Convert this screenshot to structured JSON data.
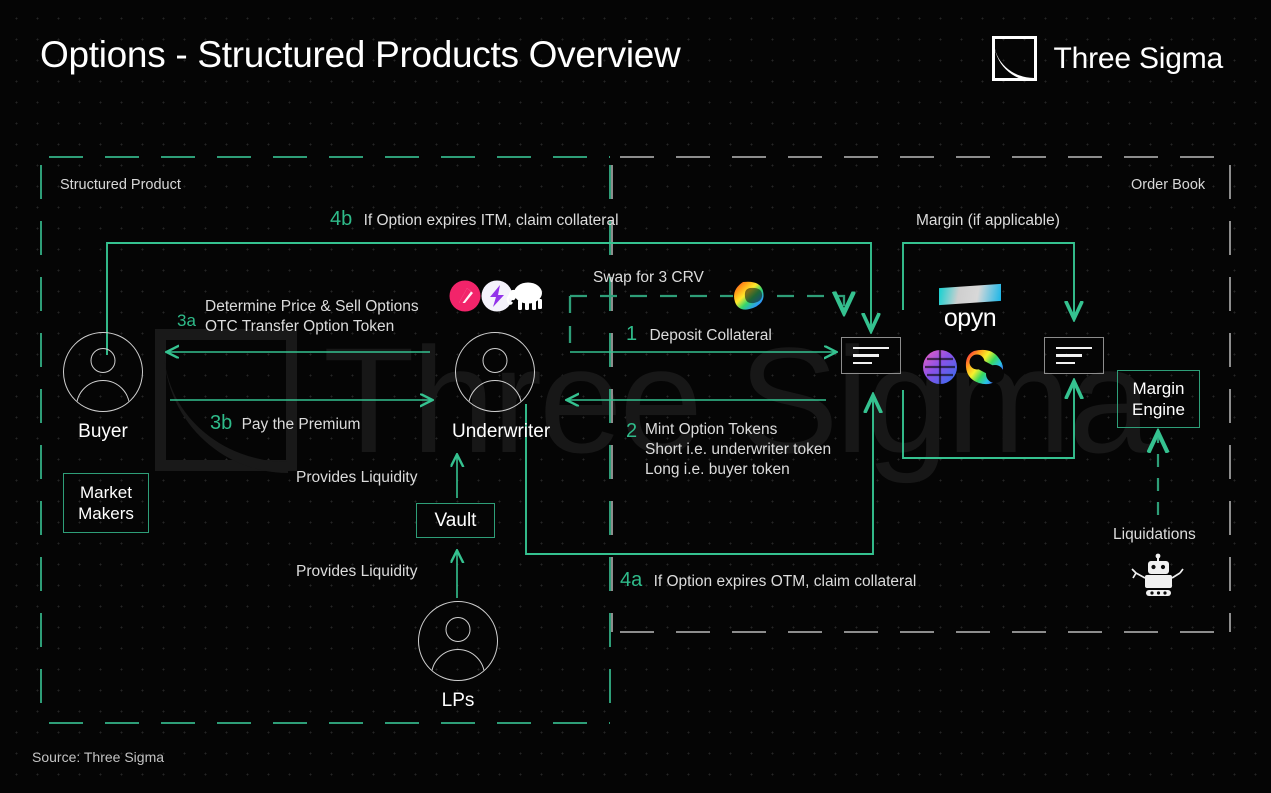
{
  "header": {
    "title": "Options - Structured Products Overview",
    "logo_text": "Three Sigma",
    "logo_mark": "three-sigma-mark"
  },
  "footer": {
    "source": "Source: Three Sigma"
  },
  "watermark": {
    "text": "Three Sigma"
  },
  "zones": {
    "structured_product": {
      "label": "Structured Product",
      "border_color": "#2e9e78",
      "style": "dashed"
    },
    "order_book": {
      "label": "Order Book",
      "border_color": "#8d8d8d",
      "style": "dashed"
    }
  },
  "colors": {
    "accent_green": "#2fbb8a",
    "line_green": "#35c290",
    "gray_line": "#8d8d8d",
    "background": "#050505",
    "text": "#dcdcdc"
  },
  "actors": [
    {
      "id": "buyer",
      "label": "Buyer",
      "icon": "user-avatar-icon"
    },
    {
      "id": "underwriter",
      "label": "Underwriter",
      "icon": "user-avatar-icon"
    },
    {
      "id": "lps",
      "label": "LPs",
      "icon": "user-avatar-icon"
    }
  ],
  "boxes": [
    {
      "id": "market-makers",
      "label": "Market\nMakers",
      "line1": "Market",
      "line2": "Makers"
    },
    {
      "id": "vault",
      "label": "Vault"
    },
    {
      "id": "margin-engine",
      "line1": "Margin",
      "line2": "Engine"
    }
  ],
  "flows": [
    {
      "id": "4b",
      "number": "4b",
      "text": "If Option expires ITM, claim collateral"
    },
    {
      "id": "3a",
      "number": "3a",
      "text_line1": "Determine Price & Sell Options",
      "text_line2": "OTC Transfer Option Token"
    },
    {
      "id": "3b",
      "number": "3b",
      "text": "Pay the Premium"
    },
    {
      "id": "1",
      "number": "1",
      "text": "Deposit Collateral"
    },
    {
      "id": "2",
      "number": "2",
      "text_line1": "Mint Option Tokens",
      "text_line2": "Short i.e. underwriter token",
      "text_line3": "Long i.e. buyer token"
    },
    {
      "id": "4a",
      "number": "4a",
      "text": "If Option expires OTM, claim collateral"
    }
  ],
  "labels": {
    "swap": "Swap for  3 CRV",
    "margin": "Margin (if applicable)",
    "provides_liquidity_1": "Provides Liquidity",
    "provides_liquidity_2": "Provides Liquidity",
    "liquidations": "Liquidations"
  },
  "protocol_icons": {
    "structured": [
      {
        "name": "ribbon-finance-icon",
        "desc": "pink circle with chevron"
      },
      {
        "name": "thetanuts-icon",
        "desc": "white circle with purple lightning bolt"
      },
      {
        "name": "mammoth-icon",
        "desc": "white mammoth silhouette"
      }
    ],
    "swap": [
      {
        "name": "curve-finance-icon",
        "desc": "rainbow gradient blob"
      }
    ],
    "orderbook": [
      {
        "name": "opyn-logo",
        "word": "opyn"
      },
      {
        "name": "premia-icon",
        "desc": "blue pink gradient globe"
      },
      {
        "name": "lyra-icon",
        "desc": "rainbow ring shape"
      }
    ],
    "orderbook_depth": [
      {
        "name": "order-book-depth-icon-left"
      },
      {
        "name": "order-book-depth-icon-right"
      }
    ],
    "liquidation_bot": {
      "name": "robot-icon"
    }
  }
}
